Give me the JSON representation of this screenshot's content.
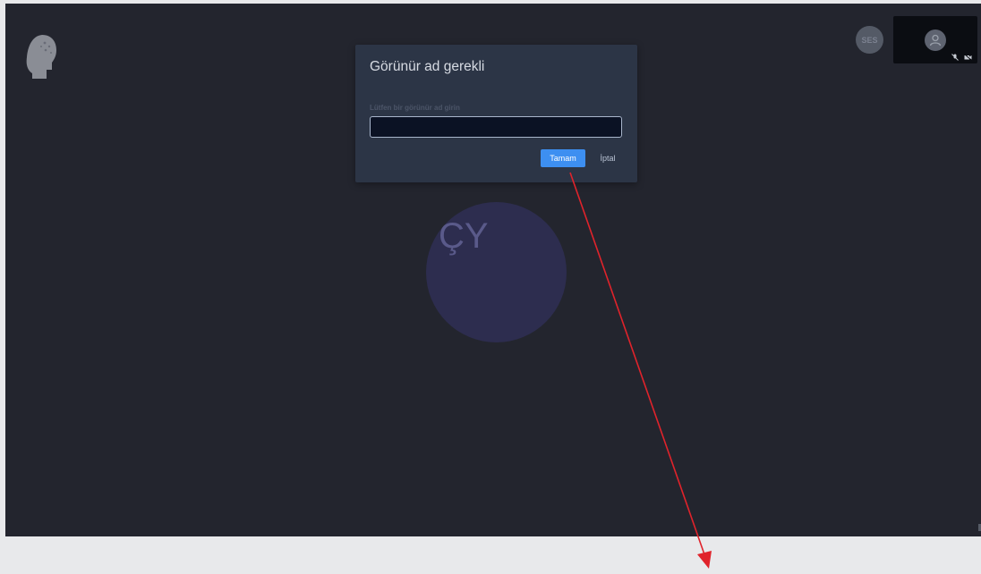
{
  "audio_badge": {
    "label": "SES"
  },
  "participant": {
    "initials": "ÇY"
  },
  "dialog": {
    "title": "Görünür ad gerekli",
    "field_label": "Lütfen bir görünür ad girin",
    "input_value": "",
    "ok_label": "Tamam",
    "cancel_label": "İptal"
  },
  "colors": {
    "background": "#23252e",
    "dialog": "#2c3546",
    "primary_button": "#3d8ff1",
    "annotation_arrow": "#e0232b"
  },
  "icons": [
    "brand-head-icon",
    "user-icon",
    "mic-off-icon",
    "video-off-icon"
  ]
}
